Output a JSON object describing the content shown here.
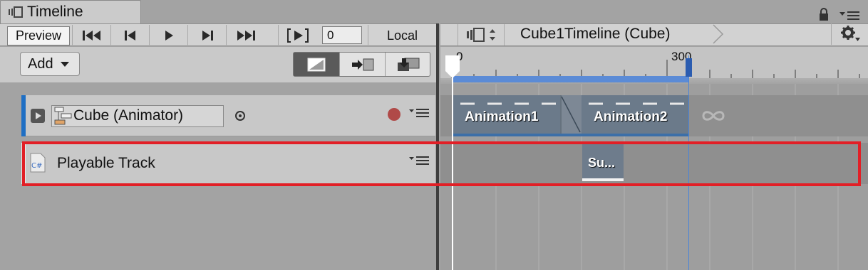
{
  "window": {
    "tab_title": "Timeline"
  },
  "toolbar": {
    "preview_label": "Preview",
    "current_time": "0",
    "space_label": "Local",
    "add_label": "Add",
    "asset_title": "Cube1Timeline (Cube)"
  },
  "ruler": {
    "labels": [
      "0",
      "300"
    ]
  },
  "tracks": [
    {
      "type": "animation",
      "binding": "Cube (Animator)",
      "color": "#1f6fc4",
      "clips": [
        "Animation1",
        "Animation2"
      ]
    },
    {
      "type": "playable",
      "label": "Playable Track",
      "icon_text": "C#",
      "clips": [
        "Su..."
      ]
    }
  ],
  "colors": {
    "highlight": "#e21f26",
    "range_bar": "#5b8bd6"
  }
}
